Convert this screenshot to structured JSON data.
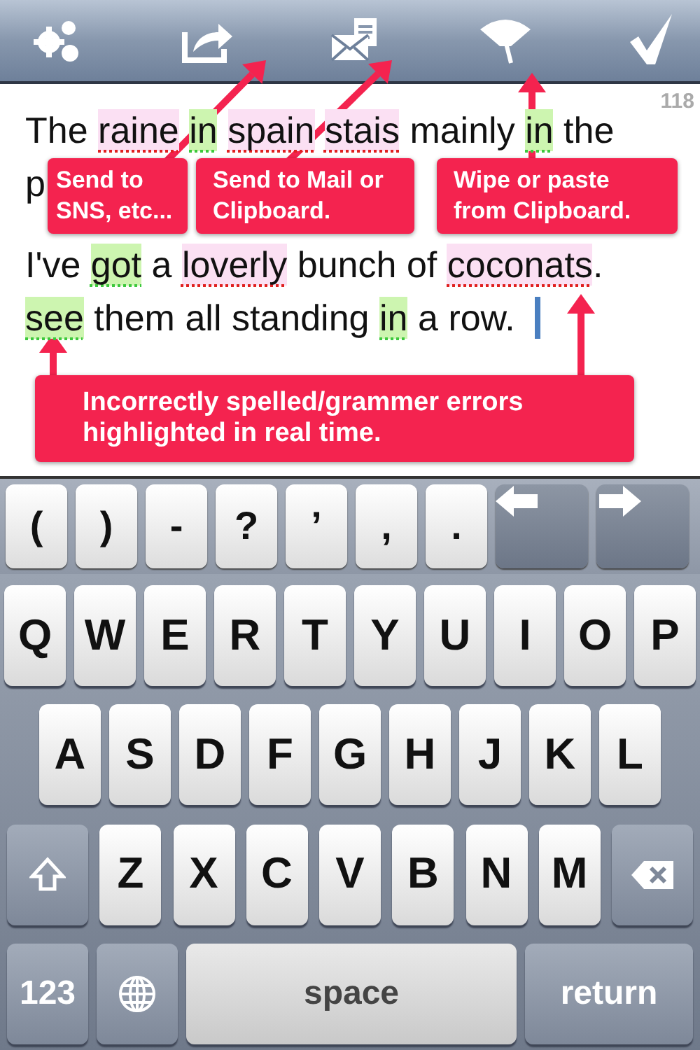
{
  "toolbar": {
    "buttons": [
      {
        "kind": "gears"
      },
      {
        "kind": "share"
      },
      {
        "kind": "mail"
      },
      {
        "kind": "wiper"
      },
      {
        "kind": "check"
      }
    ]
  },
  "editor": {
    "counter": "118",
    "cursor": true,
    "lines": [
      [
        {
          "text": "The",
          "kind": "plain"
        },
        {
          "text": "raine",
          "kind": "spelling"
        },
        {
          "text": "in",
          "kind": "grammar"
        },
        {
          "text": "spain",
          "kind": "spelling"
        },
        {
          "text": "stais",
          "kind": "spelling"
        },
        {
          "text": "mainly",
          "kind": "plain"
        },
        {
          "text": "in",
          "kind": "grammar"
        },
        {
          "text": "the",
          "kind": "plain"
        }
      ],
      [
        {
          "text": "p",
          "kind": "plain"
        }
      ],
      [
        {
          "text": "I've",
          "kind": "plain"
        },
        {
          "text": "got",
          "kind": "grammar"
        },
        {
          "text": "a",
          "kind": "plain"
        },
        {
          "text": "loverly",
          "kind": "spelling"
        },
        {
          "text": "bunch",
          "kind": "plain"
        },
        {
          "text": "of",
          "kind": "plain"
        },
        {
          "text": "coconats",
          "kind": "spelling",
          "suffix": "."
        }
      ],
      [
        {
          "text": "see",
          "kind": "grammar"
        },
        {
          "text": "them",
          "kind": "plain"
        },
        {
          "text": "all",
          "kind": "plain"
        },
        {
          "text": "standing",
          "kind": "plain"
        },
        {
          "text": "in",
          "kind": "grammar"
        },
        {
          "text": "a",
          "kind": "plain"
        },
        {
          "text": "row.",
          "kind": "plain"
        }
      ]
    ]
  },
  "callouts": [
    {
      "text": "Send to SNS, etc..."
    },
    {
      "text": "Send to Mail or Clipboard."
    },
    {
      "text": "Wipe or paste from Clipboard."
    },
    {
      "text": "Incorrectly spelled/grammer errors highlighted in real time."
    }
  ],
  "accessory_keys": [
    {
      "kind": "char",
      "label": "("
    },
    {
      "kind": "char",
      "label": ")"
    },
    {
      "kind": "char",
      "label": "-"
    },
    {
      "kind": "char",
      "label": "?"
    },
    {
      "kind": "char",
      "label": "’"
    },
    {
      "kind": "char",
      "label": ","
    },
    {
      "kind": "char",
      "label": "."
    },
    {
      "kind": "left"
    },
    {
      "kind": "right"
    }
  ],
  "keyboard": [
    [
      {
        "kind": "letter",
        "label": "Q"
      },
      {
        "kind": "letter",
        "label": "W"
      },
      {
        "kind": "letter",
        "label": "E"
      },
      {
        "kind": "letter",
        "label": "R"
      },
      {
        "kind": "letter",
        "label": "T"
      },
      {
        "kind": "letter",
        "label": "Y"
      },
      {
        "kind": "letter",
        "label": "U"
      },
      {
        "kind": "letter",
        "label": "I"
      },
      {
        "kind": "letter",
        "label": "O"
      },
      {
        "kind": "letter",
        "label": "P"
      }
    ],
    [
      {
        "kind": "letter",
        "label": "A"
      },
      {
        "kind": "letter",
        "label": "S"
      },
      {
        "kind": "letter",
        "label": "D"
      },
      {
        "kind": "letter",
        "label": "F"
      },
      {
        "kind": "letter",
        "label": "G"
      },
      {
        "kind": "letter",
        "label": "H"
      },
      {
        "kind": "letter",
        "label": "J"
      },
      {
        "kind": "letter",
        "label": "K"
      },
      {
        "kind": "letter",
        "label": "L"
      }
    ],
    [
      {
        "kind": "shift"
      },
      {
        "kind": "letter",
        "label": "Z"
      },
      {
        "kind": "letter",
        "label": "X"
      },
      {
        "kind": "letter",
        "label": "C"
      },
      {
        "kind": "letter",
        "label": "V"
      },
      {
        "kind": "letter",
        "label": "B"
      },
      {
        "kind": "letter",
        "label": "N"
      },
      {
        "kind": "letter",
        "label": "M"
      },
      {
        "kind": "delete"
      }
    ],
    [
      {
        "kind": "mode",
        "label": "123"
      },
      {
        "kind": "globe"
      },
      {
        "kind": "space",
        "label": "space"
      },
      {
        "kind": "return",
        "label": "return"
      }
    ]
  ]
}
